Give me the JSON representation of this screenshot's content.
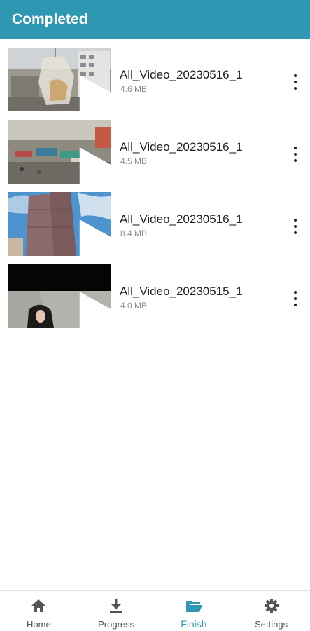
{
  "header": {
    "title": "Completed"
  },
  "colors": {
    "accent": "#2e98b3",
    "text": "#1f1f1f",
    "muted": "#8e8e8e"
  },
  "items": [
    {
      "title": "All_Video_20230516_1",
      "size": "4.6 MB",
      "thumb": "city-rooftop"
    },
    {
      "title": "All_Video_20230516_1",
      "size": "4.5 MB",
      "thumb": "street-market"
    },
    {
      "title": "All_Video_20230516_1",
      "size": "8.4 MB",
      "thumb": "tower-sky"
    },
    {
      "title": "All_Video_20230515_1",
      "size": "4.0 MB",
      "thumb": "person-dark"
    }
  ],
  "nav": [
    {
      "label": "Home",
      "icon": "home-icon"
    },
    {
      "label": "Progress",
      "icon": "download-icon"
    },
    {
      "label": "Finish",
      "icon": "folder-open-icon",
      "active": true
    },
    {
      "label": "Settings",
      "icon": "gear-icon"
    }
  ]
}
